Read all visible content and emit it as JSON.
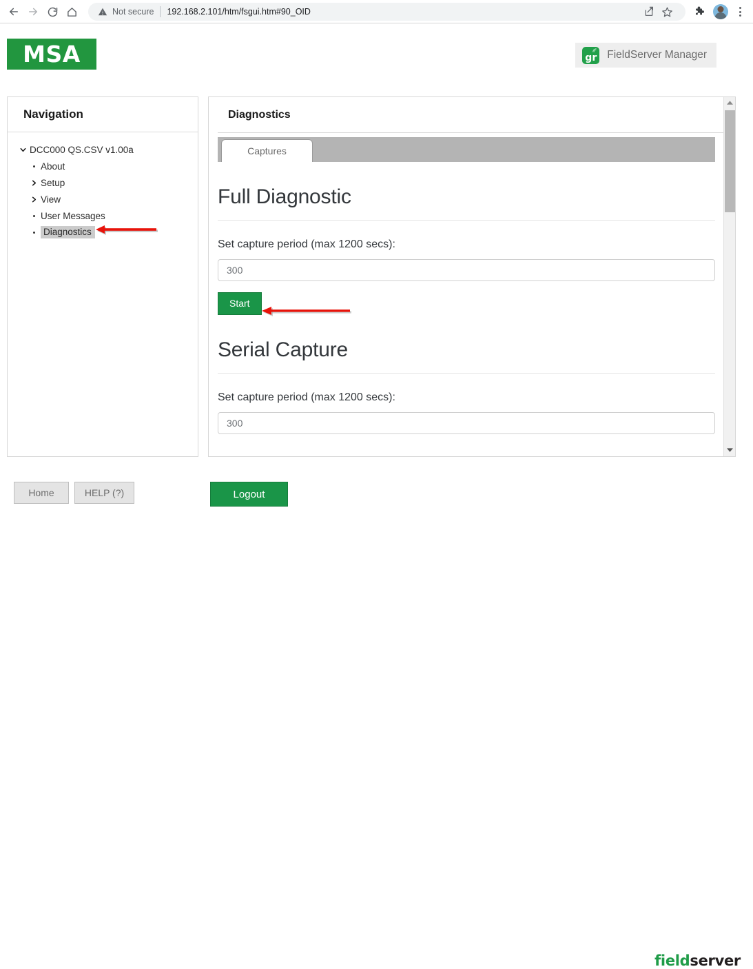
{
  "browser": {
    "back_icon": "arrow-left-icon",
    "forward_icon": "arrow-right-icon",
    "reload_icon": "reload-icon",
    "home_icon": "home-icon",
    "security_label": "Not secure",
    "security_icon": "warning-triangle-icon",
    "url": "192.168.2.101/htm/fsgui.htm#90_OID",
    "share_icon": "share-icon",
    "bookmark_icon": "star-icon",
    "extensions_icon": "puzzle-piece-icon",
    "profile_icon": "avatar",
    "menu_icon": "kebab-menu-icon"
  },
  "header": {
    "logo_text": "MSA",
    "logo_color": "#22963f",
    "manager_badge": {
      "icon_text": "gr",
      "icon_name": "fieldserver-gr-icon",
      "label": "FieldServer Manager"
    }
  },
  "sidebar": {
    "title": "Navigation",
    "items": [
      {
        "label": "DCC000 QS.CSV v1.00a",
        "marker": "chevron-down-icon",
        "level": 0,
        "selected": false
      },
      {
        "label": "About",
        "marker": "bullet",
        "level": 1,
        "selected": false
      },
      {
        "label": "Setup",
        "marker": "chevron-right-icon",
        "level": 1,
        "selected": false
      },
      {
        "label": "View",
        "marker": "chevron-right-icon",
        "level": 1,
        "selected": false
      },
      {
        "label": "User Messages",
        "marker": "bullet",
        "level": 1,
        "selected": false
      },
      {
        "label": "Diagnostics",
        "marker": "bullet",
        "level": 1,
        "selected": true
      }
    ]
  },
  "main": {
    "title": "Diagnostics",
    "tabs": [
      {
        "label": "Captures",
        "active": true
      }
    ],
    "sections": [
      {
        "heading": "Full Diagnostic",
        "field_label": "Set capture period (max 1200 secs):",
        "input_value": "300",
        "input_placeholder": "300",
        "button_label": "Start"
      },
      {
        "heading": "Serial Capture",
        "field_label": "Set capture period (max 1200 secs):",
        "input_value": "300",
        "input_placeholder": "300"
      }
    ],
    "scrollbar": {
      "up_icon": "scroll-up-arrow-icon",
      "down_icon": "scroll-down-arrow-icon"
    }
  },
  "footer": {
    "home_label": "Home",
    "help_label": "HELP (?)",
    "logout_label": "Logout",
    "brand": {
      "part1": "field",
      "part2": "server",
      "color1": "#1f9c48",
      "color2": "#231f20"
    }
  },
  "annotations": {
    "arrow_color": "#e8130a",
    "arrows": [
      {
        "target": "sidebar-item-diagnostics"
      },
      {
        "target": "start-button"
      }
    ]
  }
}
